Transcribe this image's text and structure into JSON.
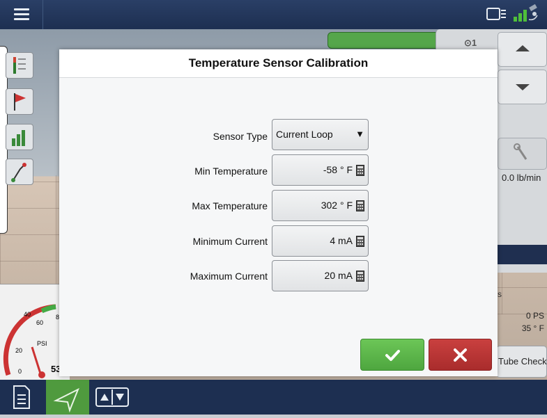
{
  "dialog": {
    "title": "Temperature Sensor Calibration",
    "fields": [
      {
        "label": "Sensor Type",
        "value": "Current Loop",
        "kind": "dropdown"
      },
      {
        "label": "Min Temperature",
        "value": "-58 ° F",
        "kind": "calculator"
      },
      {
        "label": "Max Temperature",
        "value": "302 ° F",
        "kind": "calculator"
      },
      {
        "label": "Minimum Current",
        "value": "4 mA",
        "kind": "calculator"
      },
      {
        "label": "Maximum Current",
        "value": "20 mA",
        "kind": "calculator"
      }
    ],
    "confirm_icon": "checkmark-icon",
    "cancel_icon": "x-icon"
  },
  "background": {
    "product_count": "1",
    "rate": "0.0 lb/min",
    "pressure": "0 PS",
    "temperature": "35 ° F",
    "section_label": "s",
    "tube_check_label": "Tube Check",
    "gauge": {
      "ticks": [
        "0",
        "20",
        "40",
        "60",
        "8"
      ],
      "unit": "PSI",
      "reading": "53"
    }
  },
  "colors": {
    "top_bar": "#1d2f51",
    "confirm": "#4ea63f",
    "cancel": "#a92c2c",
    "active_nav": "#4f9a3e"
  }
}
